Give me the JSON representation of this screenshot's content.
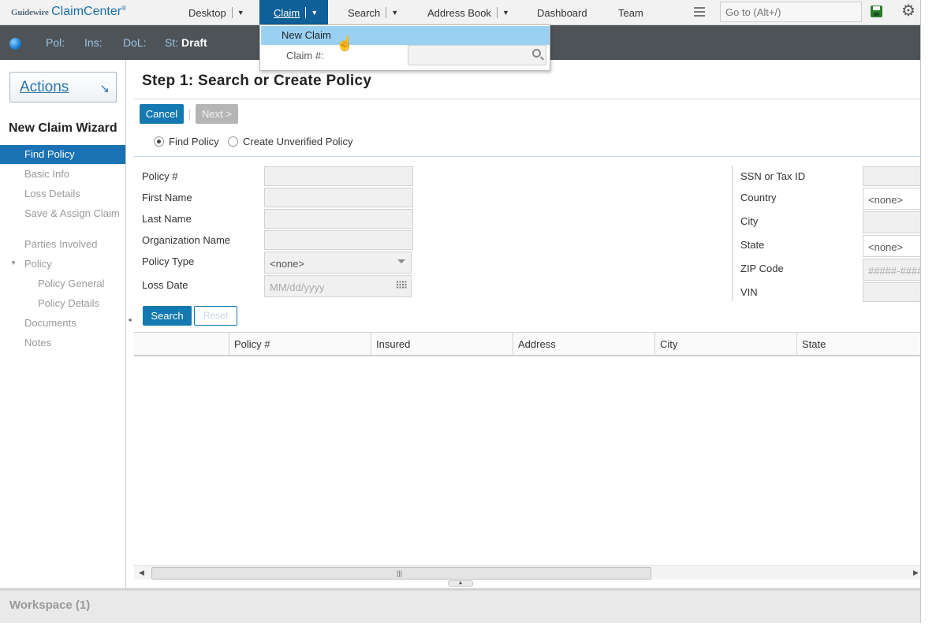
{
  "brand": {
    "vendor": "Guidewire",
    "product": "ClaimCenter",
    "mark": "®"
  },
  "nav": {
    "desktop": "Desktop",
    "claim": "Claim",
    "search": "Search",
    "address_book": "Address Book",
    "dashboard": "Dashboard",
    "team": "Team",
    "goto_placeholder": "Go to (Alt+/)"
  },
  "claim_menu": {
    "new_claim": "New Claim",
    "claim_number_label": "Claim #:",
    "claim_number_value": ""
  },
  "info_bar": {
    "pol_label": "Pol:",
    "ins_label": "Ins:",
    "dol_label": "DoL:",
    "st_label": "St:",
    "st_value": "Draft"
  },
  "sidebar": {
    "actions_label": "Actions",
    "wizard_title": "New Claim Wizard",
    "items": [
      {
        "label": "Find Policy",
        "state": "active"
      },
      {
        "label": "Basic Info",
        "state": "disabled"
      },
      {
        "label": "Loss Details",
        "state": "disabled"
      },
      {
        "label": "Save & Assign Claim",
        "state": "disabled"
      },
      {
        "label": "Parties Involved",
        "state": "disabled"
      },
      {
        "label": "Policy",
        "state": "disabled"
      },
      {
        "label": "Policy General",
        "state": "disabled"
      },
      {
        "label": "Policy Details",
        "state": "disabled"
      },
      {
        "label": "Documents",
        "state": "disabled"
      },
      {
        "label": "Notes",
        "state": "disabled"
      }
    ]
  },
  "main": {
    "title": "Step 1: Search or Create Policy",
    "cancel_label": "Cancel",
    "next_label": "Next >",
    "radio_find": "Find Policy",
    "radio_create": "Create Unverified Policy",
    "selected_radio": "Find Policy"
  },
  "form": {
    "left": [
      {
        "label": "Policy #",
        "value": ""
      },
      {
        "label": "First Name",
        "value": ""
      },
      {
        "label": "Last Name",
        "value": ""
      },
      {
        "label": "Organization Name",
        "value": ""
      },
      {
        "label": "Policy Type",
        "value": "<none>"
      },
      {
        "label": "Loss Date",
        "placeholder": "MM/dd/yyyy"
      }
    ],
    "right": [
      {
        "label": "SSN or Tax ID",
        "value": ""
      },
      {
        "label": "Country",
        "value": "<none>"
      },
      {
        "label": "City",
        "value": ""
      },
      {
        "label": "State",
        "value": "<none>"
      },
      {
        "label": "ZIP Code",
        "placeholder": "#####-####"
      },
      {
        "label": "VIN",
        "value": ""
      }
    ],
    "search_label": "Search",
    "reset_label": "Reset"
  },
  "results": {
    "columns": [
      "",
      "Policy #",
      "Insured",
      "Address",
      "City",
      "State"
    ],
    "rows": []
  },
  "workspace": {
    "label": "Workspace (1)"
  },
  "colors": {
    "primary": "#1479b0",
    "nav_active": "#0f5f98",
    "info_bar": "#4e5358",
    "menu_highlight": "#9ad1f2"
  }
}
